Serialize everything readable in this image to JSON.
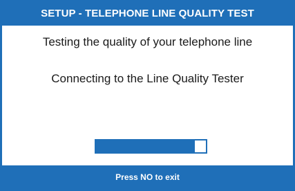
{
  "header": {
    "title": "SETUP - TELEPHONE LINE QUALITY TEST"
  },
  "body": {
    "line1": "Testing the quality of your telephone line",
    "line2": "Connecting to the Line Quality Tester"
  },
  "progress": {
    "fraction": 0.9
  },
  "footer": {
    "hint": "Press NO to exit"
  },
  "colors": {
    "accent": "#1f6fb8",
    "background": "#ffffff",
    "text": "#1a1a1a"
  }
}
